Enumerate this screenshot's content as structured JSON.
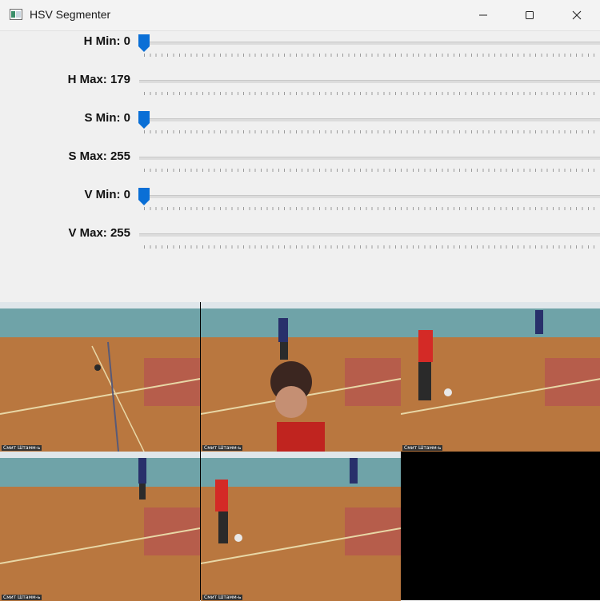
{
  "window": {
    "title": "HSV Segmenter",
    "icon": "app-window-icon",
    "controls": [
      "minimize-icon",
      "maximize-icon",
      "close-icon"
    ]
  },
  "trackbars": [
    {
      "label": "H Min: 0",
      "value": 0,
      "max": 179,
      "thumb_visible": true
    },
    {
      "label": "H Max: 179",
      "value": 179,
      "max": 179,
      "thumb_visible": false
    },
    {
      "label": "S Min: 0",
      "value": 0,
      "max": 255,
      "thumb_visible": true
    },
    {
      "label": "S Max: 255",
      "value": 255,
      "max": 255,
      "thumb_visible": false
    },
    {
      "label": "V Min: 0",
      "value": 0,
      "max": 255,
      "thumb_visible": true
    },
    {
      "label": "V Max: 255",
      "value": 255,
      "max": 255,
      "thumb_visible": false
    }
  ],
  "thumb_color": "#0a6fd6",
  "video_tiles": [
    {
      "caption": "Смит Штамм-ь"
    },
    {
      "caption": "Смит Штамм-ь"
    },
    {
      "caption": "Смит Штамм-ь"
    },
    {
      "caption": "Смит Штамм-ь"
    },
    {
      "caption": "Смит Штамм-ь"
    }
  ]
}
